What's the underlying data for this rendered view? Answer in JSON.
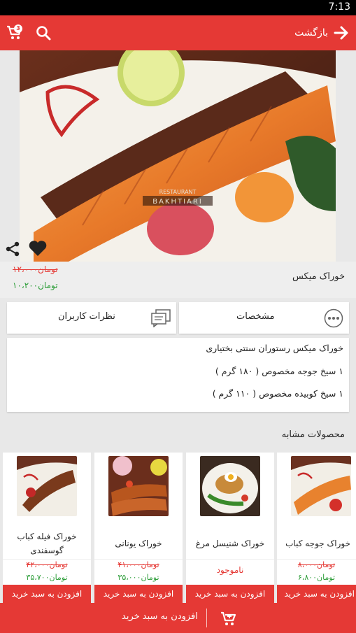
{
  "status_bar": {
    "time": "7:13"
  },
  "app_bar": {
    "back_label": "بازگشت",
    "cart_count": "3",
    "cart_icon": "cart-icon",
    "search_icon": "search-icon",
    "back_icon": "arrow-right-icon"
  },
  "hero": {
    "watermark_top": "RESTAURANT",
    "watermark_bottom": "BAKHTIARI",
    "share_icon": "share-icon",
    "favorite_icon": "heart-icon"
  },
  "product": {
    "name": "خوراک میکس",
    "old_price": "۱۲،۰۰۰تومان",
    "new_price": "۱۰،۲۰۰تومان"
  },
  "tabs": {
    "specs_label": "مشخصات",
    "reviews_label": "نظرات کاربران"
  },
  "description": {
    "lines": [
      "خوراک میکس رستوران سنتی بختیاری",
      "۱ سیخ جوجه مخصوص ( ۱۸۰ گرم )",
      "۱ سیخ کوبیده مخصوص ( ۱۱۰ گرم )"
    ]
  },
  "similar": {
    "title": "محصولات مشابه",
    "items": [
      {
        "name": "خوراک فیله کباب گوسفندی",
        "old_price": "۴۲،۰۰۰تومان",
        "new_price": "۳۵،۷۰۰تومان",
        "add_label": "افزودن به سبد خرید"
      },
      {
        "name": "خوراک یونانی",
        "old_price": "۴۱،۰۰۰تومان",
        "new_price": "۳۵،۰۰۰تومان",
        "add_label": "افزودن به سبد خرید"
      },
      {
        "name": "خوراک شنیسل مرغ",
        "status": "ناموجود",
        "add_label": "افزودن به سبد خرید"
      },
      {
        "name": "خوراک جوجه کباب",
        "old_price": "۸،۰۰۰تومان",
        "new_price": "۶،۸۰۰تومان",
        "add_label": "افزودن به سبد خرید"
      }
    ]
  },
  "bottom_bar": {
    "add_label": "افزودن به سبد خرید"
  },
  "colors": {
    "primary": "#e53935",
    "discount": "#2e9e3a"
  }
}
